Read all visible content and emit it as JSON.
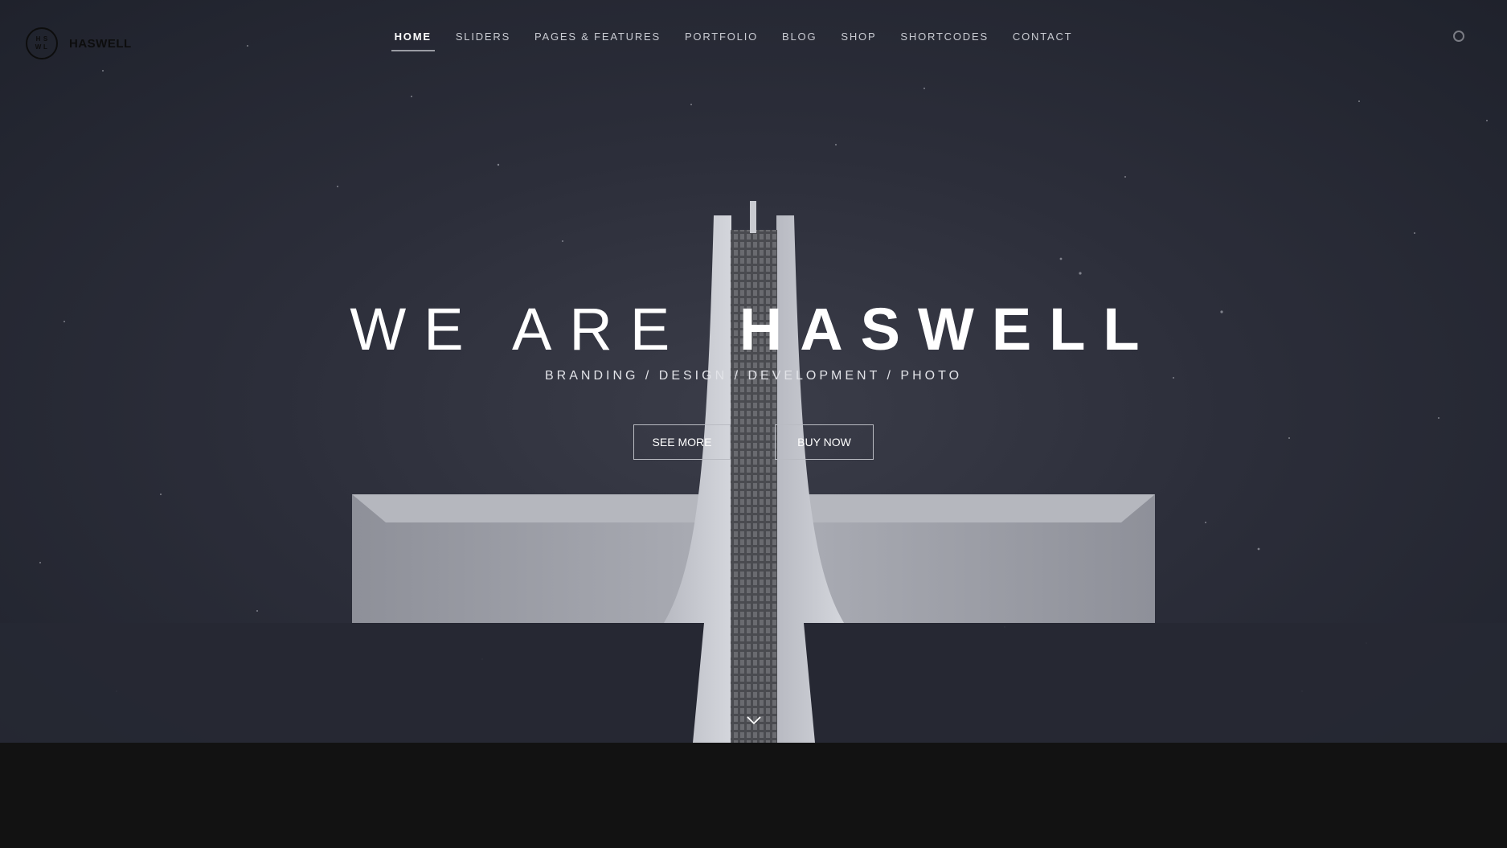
{
  "brand": {
    "mark": [
      "H",
      "S",
      "W",
      "L"
    ],
    "name": "HASWELL"
  },
  "nav": {
    "items": [
      {
        "label": "HOME",
        "active": true
      },
      {
        "label": "SLIDERS"
      },
      {
        "label": "PAGES & FEATURES"
      },
      {
        "label": "PORTFOLIO"
      },
      {
        "label": "BLOG"
      },
      {
        "label": "SHOP"
      },
      {
        "label": "SHORTCODES"
      },
      {
        "label": "CONTACT"
      }
    ]
  },
  "search": {
    "icon": "search-icon"
  },
  "hero": {
    "headline_light": "WE ARE",
    "headline_bold": "HASWELL",
    "subline": "BRANDING / DESIGN / DEVELOPMENT / PHOTO",
    "see_more": "SEE MORE",
    "buy_now": "BUY NOW",
    "scroll_icon": "chevron-down-icon"
  },
  "colors": {
    "sky": "#2c2e3a",
    "text": "#ffffff",
    "footer": "#121212"
  }
}
